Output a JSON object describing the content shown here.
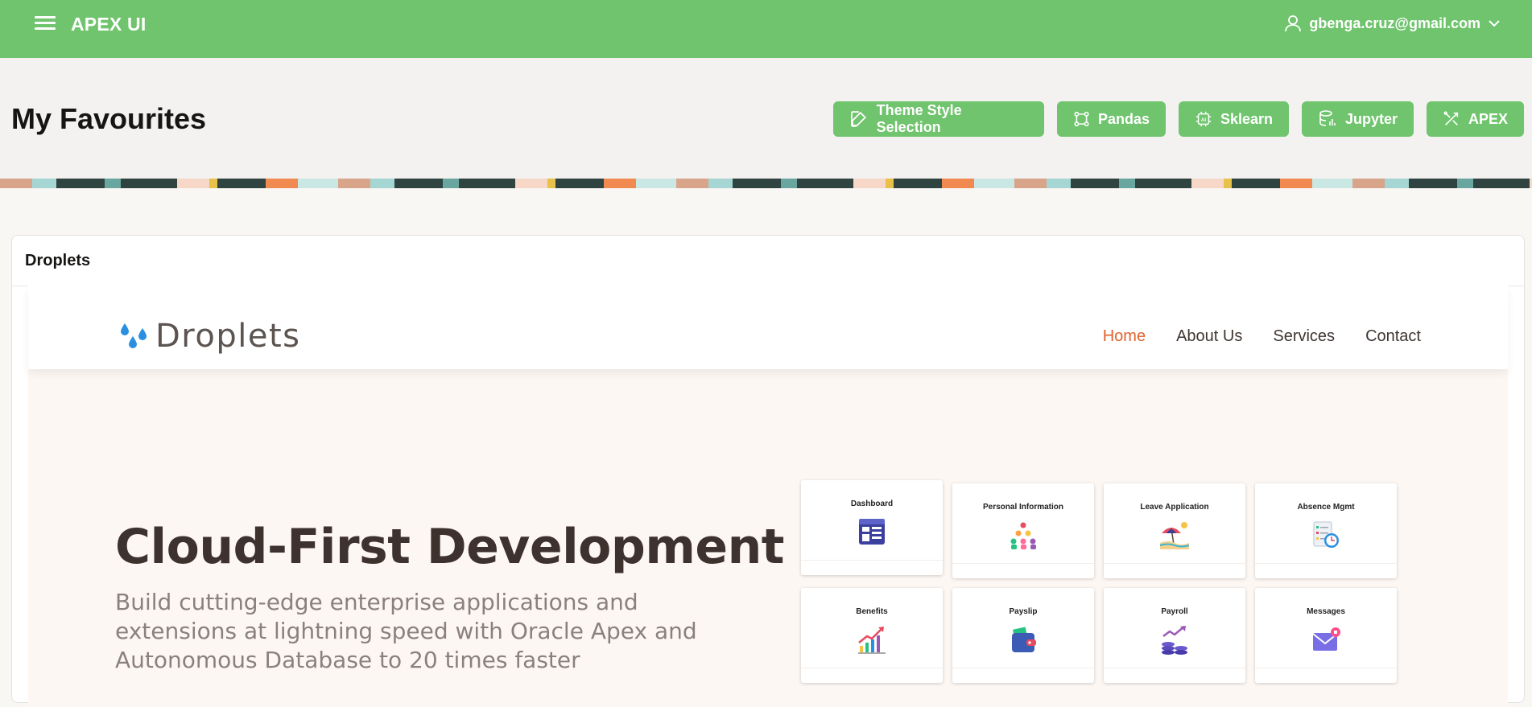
{
  "app": {
    "title": "APEX UI",
    "user_email": "gbenga.cruz@gmail.com"
  },
  "page": {
    "title": "My Favourites",
    "buttons": [
      {
        "label": "Theme Style Selection",
        "icon": "edit-icon"
      },
      {
        "label": "Pandas",
        "icon": "nodes-icon"
      },
      {
        "label": "Sklearn",
        "icon": "ai-chip-icon"
      },
      {
        "label": "Jupyter",
        "icon": "database-chart-icon"
      },
      {
        "label": "APEX",
        "icon": "tools-icon"
      }
    ]
  },
  "region": {
    "title": "Droplets"
  },
  "site": {
    "logo_text": "Droplets",
    "nav": [
      {
        "label": "Home",
        "active": true
      },
      {
        "label": "About Us",
        "active": false
      },
      {
        "label": "Services",
        "active": false
      },
      {
        "label": "Contact",
        "active": false
      }
    ],
    "hero_title": "Cloud-First Development",
    "hero_subtitle": "Build cutting-edge enterprise applications and extensions at lightning speed with Oracle Apex and Autonomous Database to 20 times faster",
    "tiles": [
      {
        "label": "Dashboard",
        "icon": "dashboard-icon"
      },
      {
        "label": "Personal Information",
        "icon": "people-icon"
      },
      {
        "label": "Leave Application",
        "icon": "beach-icon"
      },
      {
        "label": "Absence Mgmt",
        "icon": "clock-checklist-icon"
      },
      {
        "label": "Benefits",
        "icon": "growth-chart-icon"
      },
      {
        "label": "Payslip",
        "icon": "wallet-icon"
      },
      {
        "label": "Payroll",
        "icon": "coins-icon"
      },
      {
        "label": "Messages",
        "icon": "envelope-icon"
      }
    ]
  },
  "colors": {
    "brand_green": "#6fc46d",
    "nav_active": "#e0622c"
  }
}
